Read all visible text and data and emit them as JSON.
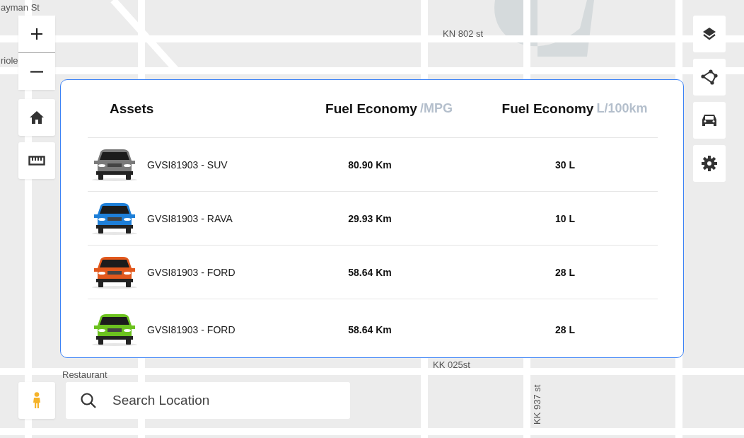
{
  "map_labels": [
    {
      "text": "ayman St",
      "kind": "h"
    },
    {
      "text": "riole",
      "kind": "h"
    },
    {
      "text": "KN 802 st",
      "kind": "h"
    },
    {
      "text": "KK 025st",
      "kind": "h"
    },
    {
      "text": "Restaurant",
      "kind": "h"
    },
    {
      "text": "KK 937 st",
      "kind": "v"
    }
  ],
  "table": {
    "columns": [
      {
        "label": "Assets"
      },
      {
        "label": "Fuel Economy",
        "unit": "/MPG"
      },
      {
        "label": "Fuel Economy",
        "unit": "L/100km"
      }
    ],
    "rows": [
      {
        "name": "GVSI81903 - SUV",
        "color": "#7a7a7a",
        "mpg": "80.90 Km",
        "l100": "30 L"
      },
      {
        "name": "GVSI81903 - RAVA",
        "color": "#1e7fd8",
        "mpg": "29.93 Km",
        "l100": "10 L"
      },
      {
        "name": "GVSI81903 - FORD",
        "color": "#e2581c",
        "mpg": "58.64 Km",
        "l100": "28 L"
      },
      {
        "name": "GVSI81903 - FORD",
        "color": "#6cc21f",
        "mpg": "58.64 Km",
        "l100": "28 L"
      }
    ]
  },
  "search": {
    "placeholder": "Search Location"
  }
}
